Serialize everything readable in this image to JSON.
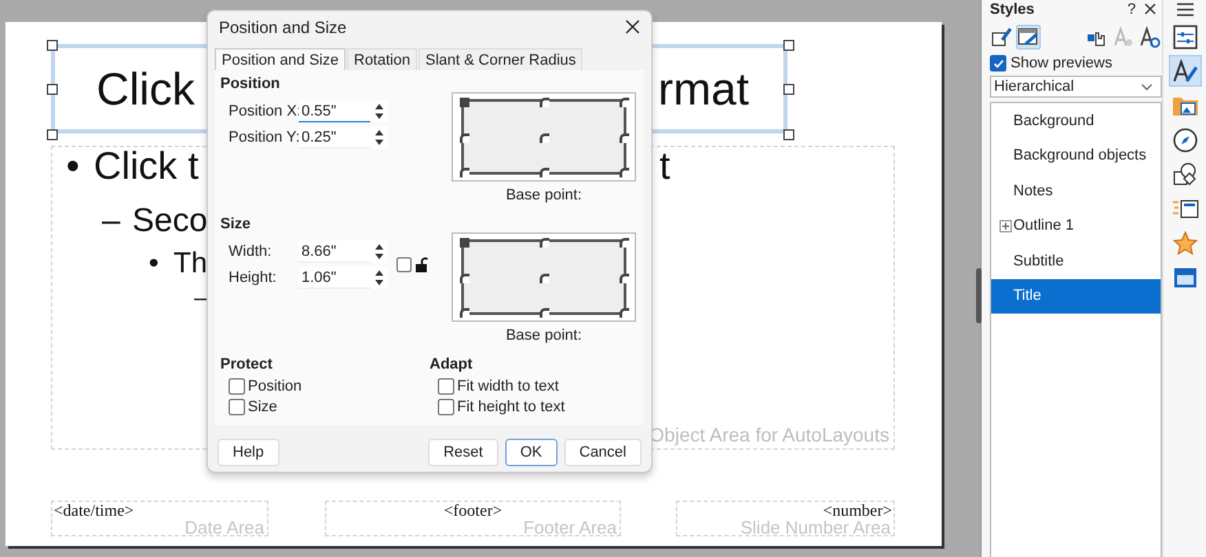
{
  "slide": {
    "title": {
      "left": "Click",
      "right": "rmat"
    },
    "outline": [
      {
        "marker": "•",
        "text": "Click t",
        "tail": "t",
        "children": [
          {
            "marker": "–",
            "text": "Seco",
            "children": [
              {
                "marker": "•",
                "text": "Th",
                "children": [
                  {
                    "marker": "–"
                  }
                ]
              }
            ]
          }
        ]
      }
    ],
    "object_area_label": "Object Area for AutoLayouts",
    "footer_areas": [
      {
        "kind": "date",
        "field": "<date/time>",
        "label": "Date Area"
      },
      {
        "kind": "footer",
        "field": "<footer>",
        "label": "Footer Area"
      },
      {
        "kind": "number",
        "field": "<number>",
        "label": "Slide Number Area"
      }
    ]
  },
  "dialog": {
    "title": "Position and Size",
    "tabs": [
      {
        "label": "Position and Size",
        "selected": true
      },
      {
        "label": "Rotation",
        "selected": false
      },
      {
        "label": "Slant & Corner Radius",
        "selected": false
      }
    ],
    "position": {
      "heading": "Position",
      "fields": [
        {
          "label": "Position X:",
          "value": "0.55\"",
          "focused": true
        },
        {
          "label": "Position Y:",
          "value": "0.25\"",
          "focused": false
        }
      ],
      "base_point_label": "Base point:",
      "points": [
        {
          "selected": true
        },
        {
          "selected": false
        },
        {
          "selected": false
        },
        {
          "selected": false
        },
        {
          "selected": false
        },
        {
          "selected": false
        },
        {
          "selected": false
        },
        {
          "selected": false
        },
        {
          "selected": false
        }
      ]
    },
    "size": {
      "heading": "Size",
      "fields": [
        {
          "label": "Width:",
          "value": "8.66\"",
          "focused": false
        },
        {
          "label": "Height:",
          "value": "1.06\"",
          "focused": false
        }
      ],
      "keep_ratio": false,
      "base_point_label": "Base point:",
      "points": [
        {
          "selected": true
        },
        {
          "selected": false
        },
        {
          "selected": false
        },
        {
          "selected": false
        },
        {
          "selected": false
        },
        {
          "selected": false
        },
        {
          "selected": false
        },
        {
          "selected": false
        },
        {
          "selected": false
        }
      ]
    },
    "protect": {
      "heading": "Protect",
      "options": [
        {
          "label": "Position",
          "checked": false
        },
        {
          "label": "Size",
          "checked": false
        }
      ]
    },
    "adapt": {
      "heading": "Adapt",
      "options": [
        {
          "label": "Fit width to text",
          "checked": false
        },
        {
          "label": "Fit height to text",
          "checked": false
        }
      ]
    },
    "buttons": [
      {
        "label": "Help",
        "default": false
      },
      {
        "label": "Reset",
        "default": false
      },
      {
        "label": "OK",
        "default": true
      },
      {
        "label": "Cancel",
        "default": false
      }
    ]
  },
  "styles": {
    "title": "Styles",
    "help": "?",
    "toolbar": [
      {
        "selected": false,
        "disabled": false
      },
      {
        "selected": true,
        "disabled": false
      },
      {
        "selected": false,
        "disabled": false
      },
      {
        "selected": false,
        "disabled": true
      },
      {
        "selected": false,
        "disabled": false
      }
    ],
    "show_previews": {
      "label": "Show previews",
      "checked": true
    },
    "filter": {
      "value": "Hierarchical"
    },
    "items": [
      {
        "label": "Background",
        "selected": false,
        "expandable": false
      },
      {
        "label": "Background objects",
        "selected": false,
        "expandable": false
      },
      {
        "label": "Notes",
        "selected": false,
        "expandable": false
      },
      {
        "label": "Outline 1",
        "selected": false,
        "expandable": true
      },
      {
        "label": "Subtitle",
        "selected": false,
        "expandable": false
      },
      {
        "label": "Title",
        "selected": true,
        "expandable": false
      }
    ]
  },
  "deck": [
    {
      "selected": false
    },
    {
      "selected": true
    },
    {
      "selected": false
    },
    {
      "selected": false
    },
    {
      "selected": false
    },
    {
      "selected": false
    },
    {
      "selected": false
    },
    {
      "selected": false
    }
  ]
}
